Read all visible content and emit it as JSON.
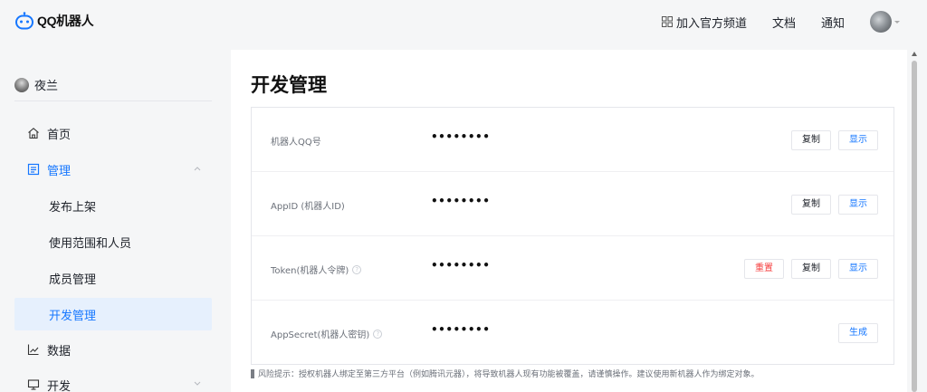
{
  "app": {
    "logo_text": "QQ机器人"
  },
  "topnav": {
    "join_channel": "加入官方频道",
    "docs": "文档",
    "notifications": "通知"
  },
  "sidebar": {
    "user_name": "夜兰",
    "items": [
      {
        "label": "首页",
        "icon": "home-icon"
      },
      {
        "label": "管理",
        "icon": "manage-icon"
      },
      {
        "label": "发布上架"
      },
      {
        "label": "使用范围和人员"
      },
      {
        "label": "成员管理"
      },
      {
        "label": "开发管理"
      },
      {
        "label": "数据",
        "icon": "chart-icon"
      },
      {
        "label": "开发",
        "icon": "monitor-icon"
      }
    ]
  },
  "main": {
    "title": "开发管理",
    "rows": [
      {
        "label": "机器人QQ号",
        "value": "••••••••",
        "actions": [
          "复制",
          "显示"
        ]
      },
      {
        "label": "AppID (机器人ID)",
        "value": "••••••••",
        "actions": [
          "复制",
          "显示"
        ]
      },
      {
        "label": "Token(机器人令牌)",
        "value": "••••••••",
        "actions": [
          "重置",
          "复制",
          "显示"
        ]
      },
      {
        "label": "AppSecret(机器人密钥)",
        "value": "••••••••",
        "actions": [
          "生成"
        ]
      }
    ],
    "help_glyph": "?",
    "risk_notice": "风险提示：授权机器人绑定至第三方平台（例如腾讯元器），将导致机器人现有功能被覆盖，请谨慎操作。建议使用新机器人作为绑定对象。"
  },
  "colors": {
    "accent": "#1677ff",
    "danger": "#f53f3f",
    "active_bg": "#e6f0fd"
  }
}
